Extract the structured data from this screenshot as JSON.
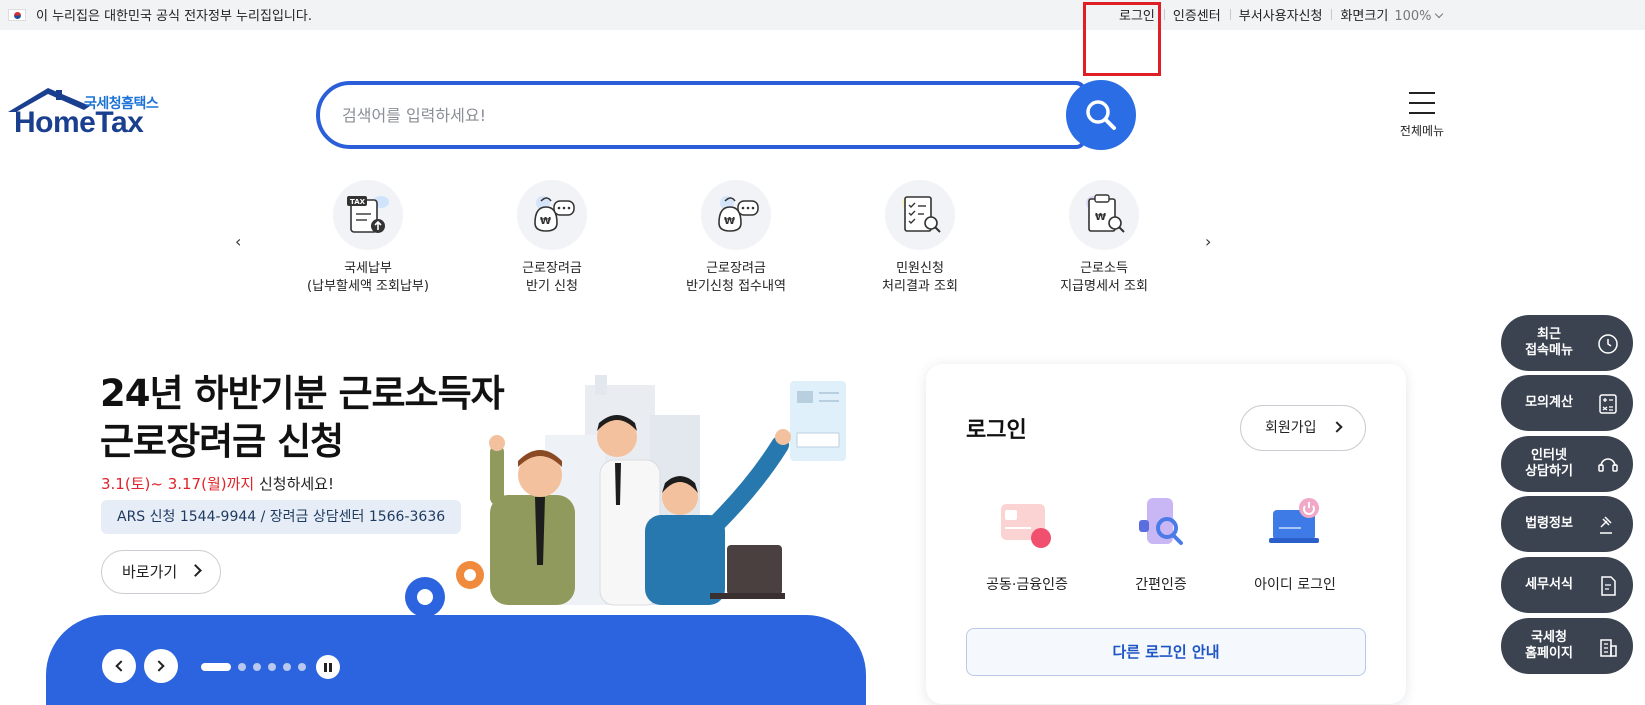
{
  "topbar": {
    "gov_notice": "이 누리집은 대한민국 공식 전자정부 누리집입니다.",
    "login": "로그인",
    "cert_center": "인증센터",
    "dept_user": "부서사용자신청",
    "screen_size": "화면크기",
    "zoom": "100%"
  },
  "logo": {
    "korean": "국세청홈택스",
    "english": "HomeTax"
  },
  "search": {
    "placeholder": "검색어를 입력하세요!",
    "value": ""
  },
  "allmenu_label": "전체메뉴",
  "quick_menu": [
    {
      "line1": "국세납부",
      "line2": "(납부할세액 조회납부)",
      "icon": "tax-payment-icon"
    },
    {
      "line1": "근로장려금",
      "line2": "반기 신청",
      "icon": "money-bag-chat-icon"
    },
    {
      "line1": "근로장려금",
      "line2": "반기신청 접수내역",
      "icon": "money-bag-chat-icon"
    },
    {
      "line1": "민원신청",
      "line2": "처리결과 조회",
      "icon": "document-search-icon"
    },
    {
      "line1": "근로소득",
      "line2": "지급명세서 조회",
      "icon": "statement-search-icon"
    }
  ],
  "hero": {
    "title_line1": "24년 하반기분 근로소득자",
    "title_line2": "근로장려금 신청",
    "date_red": "3.1(토)~ 3.17(월)까지",
    "date_rest": " 신청하세요!",
    "phone": "ARS 신청 1544-9944 / 장려금 상담센터 1566-3636",
    "go_button": "바로가기",
    "slide_count": 6,
    "active_slide": 1
  },
  "login_card": {
    "title": "로그인",
    "join": "회원가입",
    "methods": [
      "공동·금융인증",
      "간편인증",
      "아이디 로그인"
    ],
    "other": "다른 로그인 안내"
  },
  "side_menu": [
    {
      "line1": "최근",
      "line2": "접속메뉴",
      "icon": "clock-icon"
    },
    {
      "line1": "모의계산",
      "line2": "",
      "icon": "calculator-icon"
    },
    {
      "line1": "인터넷",
      "line2": "상담하기",
      "icon": "chat-headset-icon"
    },
    {
      "line1": "법령정보",
      "line2": "",
      "icon": "gavel-icon"
    },
    {
      "line1": "세무서식",
      "line2": "",
      "icon": "form-document-icon"
    },
    {
      "line1": "국세청",
      "line2": "홈페이지",
      "icon": "building-icon"
    }
  ],
  "colors": {
    "brand_blue": "#2b64de",
    "logo_navy": "#1a3f8f",
    "highlight_red": "#e01e26",
    "side_dark": "#3b4350"
  }
}
